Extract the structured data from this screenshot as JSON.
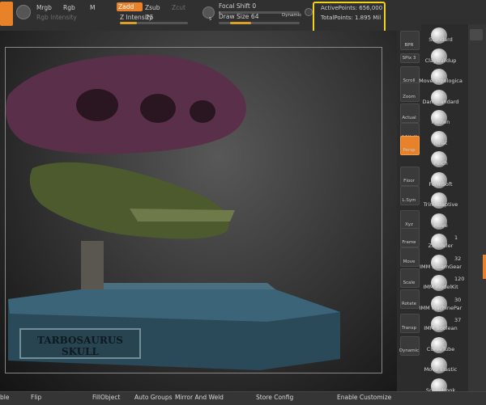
{
  "toolbar": {
    "mrgb": "Mrgb",
    "rgb": "Rgb",
    "m": "M",
    "zadd": "Zadd",
    "zsub": "Zsub",
    "zcut": "Zcut",
    "rgb_intensity": "Rgb Intensity",
    "z_intensity_label": "Z Intensity",
    "z_intensity_value": "25",
    "z_intensity_level": 0.25,
    "focal_shift_label": "Focal Shift",
    "focal_shift_value": "0",
    "draw_size_label": "Draw Size",
    "draw_size_value": "64",
    "dynamic": "Dynamic",
    "active_points": "ActivePoints: 656,000",
    "total_points": "TotalPoints: 1.895 Mil"
  },
  "viewport": {
    "plaque_text": "TARBOSAURUS SKULL"
  },
  "shelf": {
    "items": [
      {
        "label": "BPR"
      },
      {
        "label": "SPix",
        "value": "3"
      },
      {
        "label": "Scroll"
      },
      {
        "label": "Zoom"
      },
      {
        "label": "Actual"
      },
      {
        "label": "AAHalf"
      },
      {
        "label": "Persp"
      },
      {
        "label": "Floor"
      },
      {
        "label": "L.Sym"
      },
      {
        "label": "Xyz"
      },
      {
        "label": "Frame"
      },
      {
        "label": "Move"
      },
      {
        "label": "Scale"
      },
      {
        "label": "Rotate"
      },
      {
        "label": "Transp"
      },
      {
        "label": "Dynamic"
      }
    ]
  },
  "brushes": [
    {
      "name": "Standard",
      "count": ""
    },
    {
      "name": "ClayBuildup",
      "count": ""
    },
    {
      "name": "Move Topologica",
      "count": ""
    },
    {
      "name": "DamStandard",
      "count": ""
    },
    {
      "name": "Flatten",
      "count": ""
    },
    {
      "name": "Inflat",
      "count": ""
    },
    {
      "name": "Pinch",
      "count": ""
    },
    {
      "name": "FormSoft",
      "count": ""
    },
    {
      "name": "TrimAdaptive",
      "count": ""
    },
    {
      "name": "Move",
      "count": ""
    },
    {
      "name": "ZModeler",
      "count": "1"
    },
    {
      "name": "IMM SteamGear",
      "count": "32"
    },
    {
      "name": "IMM ModelKit",
      "count": "120"
    },
    {
      "name": "IMM MachinePar",
      "count": "30"
    },
    {
      "name": "IMM Boolean",
      "count": "37"
    },
    {
      "name": "CurveTube",
      "count": ""
    },
    {
      "name": "Move Elastic",
      "count": ""
    },
    {
      "name": "SnakeHook",
      "count": ""
    }
  ],
  "bottombar": {
    "items": [
      "ble",
      "Flip",
      "FillObject",
      "Auto Groups",
      "Mirror And Weld",
      "Store Config",
      "Enable Customize"
    ]
  },
  "colors": {
    "accent": "#e8822a",
    "highlight": "#f2d21c"
  }
}
